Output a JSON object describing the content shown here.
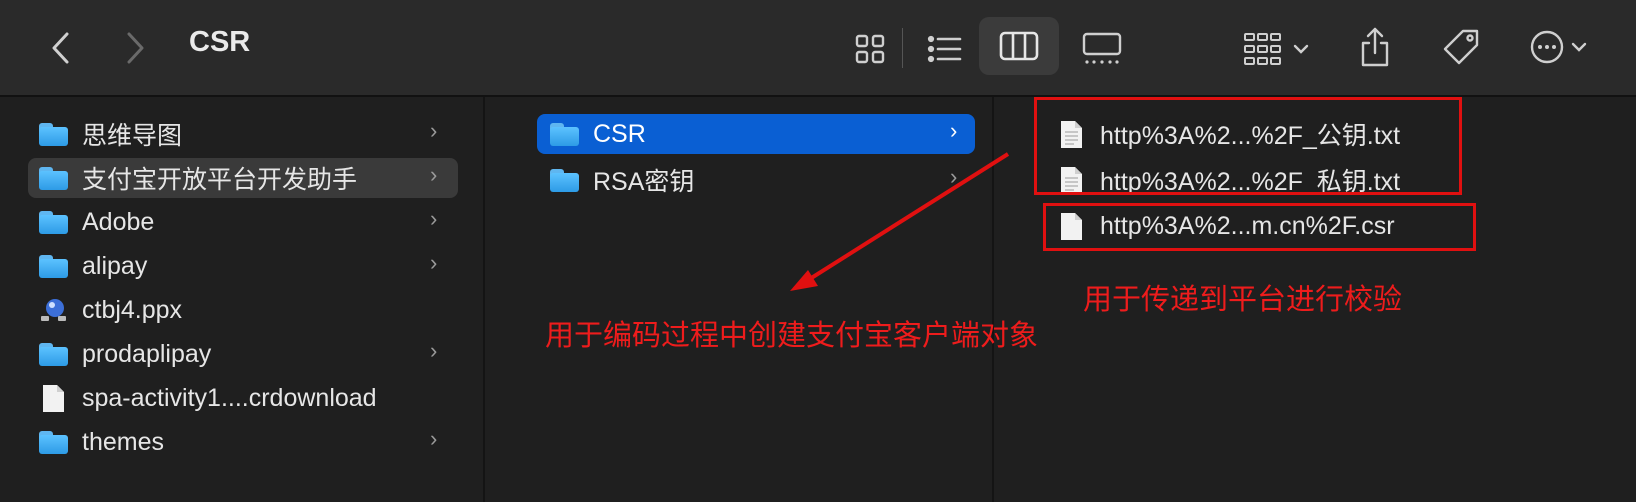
{
  "window": {
    "title": "CSR"
  },
  "toolbar": {
    "back_icon": "chevron-left-icon",
    "forward_icon": "chevron-right-icon",
    "views": [
      "icon-view",
      "list-view",
      "column-view",
      "gallery-view"
    ],
    "active_view": "column-view",
    "group_icon": "group-by-icon",
    "share_icon": "share-icon",
    "tag_icon": "tag-icon",
    "more_icon": "ellipsis-circle-icon"
  },
  "sidebar": {
    "items": [
      {
        "label": "思维导图",
        "type": "folder",
        "chevron": true
      },
      {
        "label": "支付宝开放平台开发助手",
        "type": "folder",
        "chevron": true,
        "selected": true
      },
      {
        "label": "Adobe",
        "type": "folder",
        "chevron": true
      },
      {
        "label": "alipay",
        "type": "folder",
        "chevron": true
      },
      {
        "label": "ctbj4.ppx",
        "type": "app",
        "chevron": false
      },
      {
        "label": "prodaplipay",
        "type": "folder",
        "chevron": true
      },
      {
        "label": "spa-activity1....crdownload",
        "type": "file",
        "chevron": false
      },
      {
        "label": "themes",
        "type": "folder",
        "chevron": true
      }
    ]
  },
  "column2": {
    "items": [
      {
        "label": "CSR",
        "type": "folder",
        "selected": true
      },
      {
        "label": "RSA密钥",
        "type": "folder",
        "selected": false
      }
    ]
  },
  "column3": {
    "items": [
      {
        "label": "http%3A%2...%2F_公钥.txt",
        "type": "text-file"
      },
      {
        "label": "http%3A%2...%2F_私钥.txt",
        "type": "text-file"
      },
      {
        "label": "http%3A%2...m.cn%2F.csr",
        "type": "file"
      }
    ]
  },
  "annotations": {
    "keys_note": "用于编码过程中创建支付宝客户端对象",
    "csr_note": "用于传递到平台进行校验",
    "color": "#e01010"
  }
}
